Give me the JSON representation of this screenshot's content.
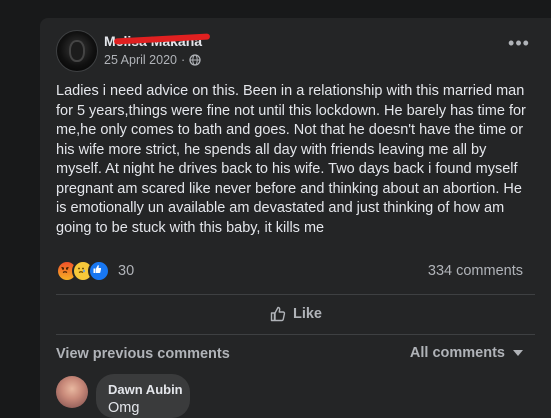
{
  "post": {
    "author": "Melisa Makana",
    "date": "25 April 2020",
    "separator": "·",
    "more_icon": "more-dots-icon",
    "text": "Ladies i need advice on this. Been in a relationship with this married man for 5 years,things were fine not until this lockdown.  He barely has time for me,he only comes to bath and goes. Not that he doesn't have the time or his wife more strict, he spends all day with friends leaving me all by myself. At night he drives back to his wife. Two days back i found myself pregnant am scared like never before and thinking about an abortion. He is emotionally un available am devastated and just thinking of how am going to be stuck with this baby, it kills me",
    "reaction_count": "30",
    "comment_count": "334 comments",
    "like_label": "Like"
  },
  "comments": {
    "view_previous": "View previous comments",
    "filter_label": "All comments",
    "items": [
      {
        "author": "Dawn Aubin",
        "text": "Omg"
      }
    ]
  },
  "colors": {
    "background": "#18191a",
    "card": "#242526",
    "bubble": "#3a3b3c",
    "secondary_text": "#b0b3b8",
    "redaction": "#e02020",
    "like_blue": "#1877f2"
  }
}
